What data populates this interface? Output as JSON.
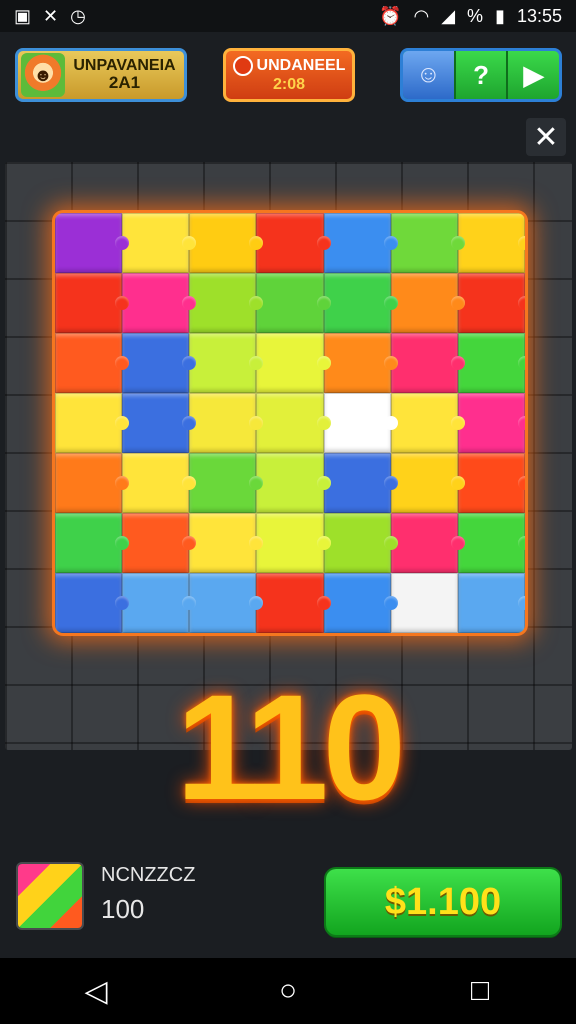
{
  "status_bar": {
    "time": "13:55",
    "battery": "%",
    "left_icons": [
      "image-icon",
      "shuffle-icon",
      "clock-icon"
    ],
    "right_icons": [
      "alarm-icon",
      "wifi-icon",
      "signal-icon",
      "battery-icon"
    ]
  },
  "header": {
    "level_title": "UNPAVANEIA",
    "level_value": "2A1",
    "timer_title": "UNDANEEL",
    "timer_value": "2:08",
    "hint_label": "?",
    "play_label": "▶",
    "ghost_label": "☺"
  },
  "close_label": "✕",
  "board": {
    "rows": 7,
    "cols": 7,
    "tiles": [
      "#9b2fd6",
      "#ffe43a",
      "#ffcc12",
      "#f5331c",
      "#3b8ef0",
      "#6fd93a",
      "#ffd21a",
      "#f5331c",
      "#ff2f8e",
      "#9ee02a",
      "#5fd33a",
      "#3fd14a",
      "#ff8a1a",
      "#f5331c",
      "#ff5a1f",
      "#3b6fe0",
      "#c8f03a",
      "#e8f53a",
      "#ff8a1a",
      "#ff2f6e",
      "#44d63c",
      "#ffe43a",
      "#3b6fe0",
      "#f6e83a",
      "#e2f03a",
      "#ffffff",
      "#ffe43a",
      "#ff2f8e",
      "#ff7a1a",
      "#ffe43a",
      "#6ad83a",
      "#c8f03a",
      "#3b6fe0",
      "#ffd21a",
      "#ff4a1a",
      "#3fd14a",
      "#ff5a1f",
      "#ffe43a",
      "#e8f53a",
      "#9ee02a",
      "#ff2f6e",
      "#44d63c",
      "#3b6fe0",
      "#5aa8f0",
      "#5aa8f0",
      "#f5331c",
      "#3b8ef0",
      "#ffffff",
      "#5aa8f0"
    ],
    "empty_positions": [
      47
    ]
  },
  "score": "110",
  "footer": {
    "puzzle_name": "NCNZZCZ",
    "puzzle_count": "100",
    "price_label": "$1.100"
  },
  "nav": {
    "back_icon": "◁",
    "home_icon": "○",
    "recents_icon": "□"
  }
}
